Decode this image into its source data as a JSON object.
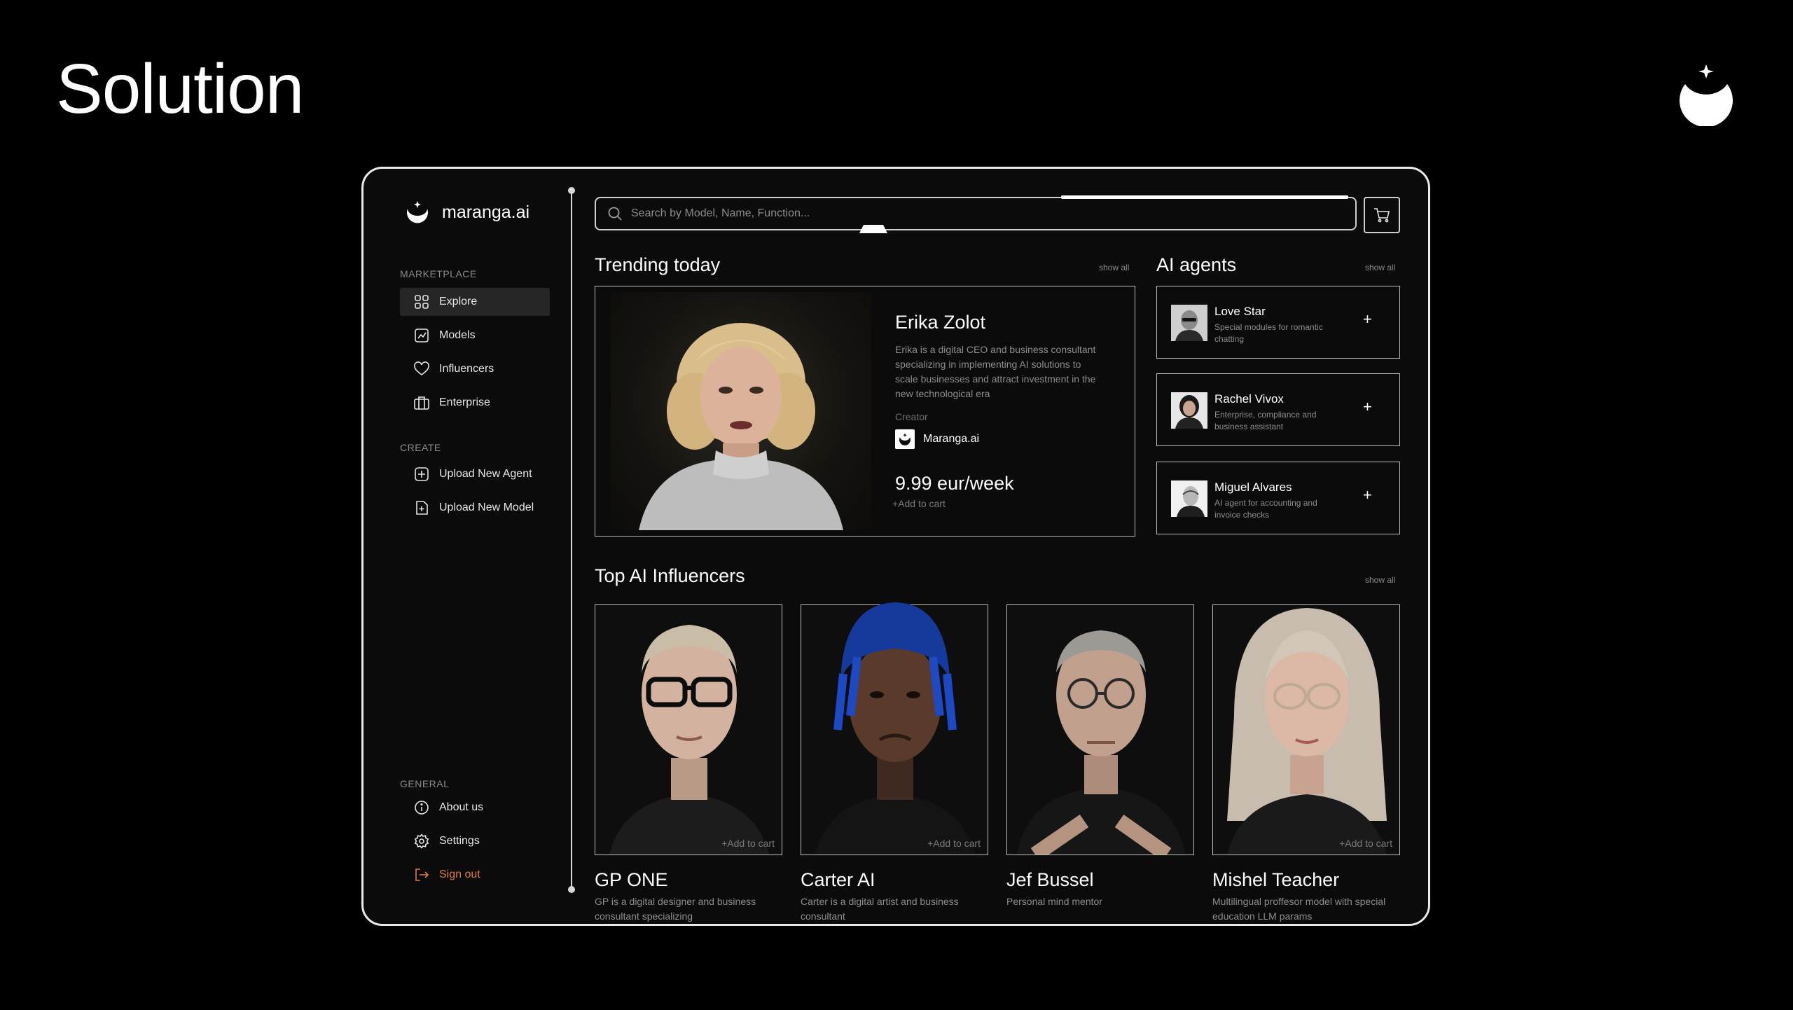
{
  "slide": {
    "title": "Solution",
    "logo_icon": "crescent-moon-star-icon"
  },
  "app": {
    "name": "maranga.ai"
  },
  "sidebar": {
    "sections": [
      {
        "label": "MARKETPLACE",
        "items": [
          {
            "label": "Explore",
            "icon": "grid-icon",
            "active": true
          },
          {
            "label": "Models",
            "icon": "chart-icon"
          },
          {
            "label": "Influencers",
            "icon": "heart-icon"
          },
          {
            "label": "Enterprise",
            "icon": "briefcase-icon"
          }
        ]
      },
      {
        "label": "CREATE",
        "items": [
          {
            "label": "Upload New Agent",
            "icon": "plus-square-icon"
          },
          {
            "label": "Upload New Model",
            "icon": "file-plus-icon"
          }
        ]
      },
      {
        "label": "GENERAL",
        "items": [
          {
            "label": "About us",
            "icon": "info-icon"
          },
          {
            "label": "Settings",
            "icon": "gear-icon"
          },
          {
            "label": "Sign out",
            "icon": "sign-out-icon",
            "accent": "#e07b3c"
          }
        ]
      }
    ]
  },
  "search": {
    "placeholder": "Search by Model, Name, Function..."
  },
  "trending": {
    "heading": "Trending today",
    "show_all": "show all",
    "name": "Erika Zolot",
    "description": "Erika is a digital CEO and business consultant specializing in implementing AI solutions to scale businesses and attract investment in the new technological era",
    "creator_label": "Creator",
    "creator": "Maranga.ai",
    "price": "9.99 eur/week",
    "add_to_cart": "+Add to cart"
  },
  "agents": {
    "heading": "AI agents",
    "show_all": "show all",
    "items": [
      {
        "name": "Love Star",
        "description": "Special modules for romantic chatting",
        "add": "+"
      },
      {
        "name": "Rachel Vivox",
        "description": "Enterprise, compliance and business assistant",
        "add": "+"
      },
      {
        "name": "Miguel Alvares",
        "description": "AI agent for accounting and invoice checks",
        "add": "+"
      }
    ]
  },
  "influencers": {
    "heading": "Top AI Influencers",
    "show_all": "show all",
    "items": [
      {
        "name": "GP ONE",
        "description": "GP is a digital designer and business consultant specializing",
        "add_to_cart": "+Add to cart"
      },
      {
        "name": "Carter AI",
        "description": "Carter is a digital artist and business consultant",
        "add_to_cart": "+Add to cart"
      },
      {
        "name": "Jef Bussel",
        "description": "Personal mind mentor",
        "add_to_cart": ""
      },
      {
        "name": "Mishel Teacher",
        "description": "Multilingual proffesor model with special education LLM params",
        "add_to_cart": "+Add to cart"
      }
    ]
  }
}
